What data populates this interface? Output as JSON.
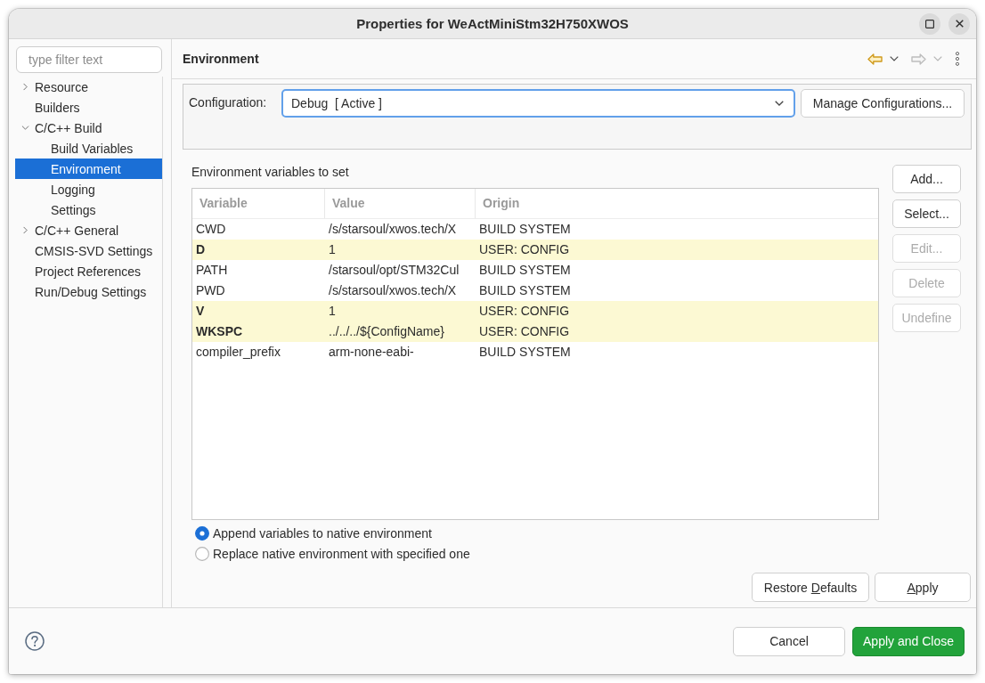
{
  "window": {
    "title": "Properties for WeActMiniStm32H750XWOS"
  },
  "sidebar": {
    "filter": {
      "placeholder": "type filter text"
    },
    "items": [
      {
        "label": "Resource",
        "kind": "group",
        "expanded": false,
        "selected": false
      },
      {
        "label": "Builders",
        "kind": "page",
        "selected": false
      },
      {
        "label": "C/C++ Build",
        "kind": "group",
        "expanded": true,
        "selected": false,
        "children": [
          {
            "label": "Build Variables",
            "kind": "page",
            "selected": false
          },
          {
            "label": "Environment",
            "kind": "page",
            "selected": true
          },
          {
            "label": "Logging",
            "kind": "page",
            "selected": false
          },
          {
            "label": "Settings",
            "kind": "page",
            "selected": false
          }
        ]
      },
      {
        "label": "C/C++ General",
        "kind": "group",
        "expanded": false,
        "selected": false
      },
      {
        "label": "CMSIS-SVD Settings",
        "kind": "page",
        "selected": false
      },
      {
        "label": "Project References",
        "kind": "page",
        "selected": false
      },
      {
        "label": "Run/Debug Settings",
        "kind": "page",
        "selected": false
      }
    ]
  },
  "page": {
    "title": "Environment",
    "history": [
      {
        "kind": "back",
        "disabled": false
      },
      {
        "kind": "forward",
        "disabled": true
      }
    ],
    "configuration": {
      "label": "Configuration:",
      "value": "Debug  [ Active ]",
      "focused": true,
      "manage_button": "Manage Configurations..."
    },
    "variables": {
      "label": "Environment variables to set",
      "columns": [
        "Variable",
        "Value",
        "Origin"
      ],
      "rows": [
        {
          "variable": "CWD",
          "value": "/s/starsoul/xwos.tech/X",
          "origin": "BUILD SYSTEM",
          "user_defined": false
        },
        {
          "variable": "D",
          "value": "1",
          "origin": "USER: CONFIG",
          "user_defined": true
        },
        {
          "variable": "PATH",
          "value": "/starsoul/opt/STM32Cul",
          "origin": "BUILD SYSTEM",
          "user_defined": false
        },
        {
          "variable": "PWD",
          "value": "/s/starsoul/xwos.tech/X",
          "origin": "BUILD SYSTEM",
          "user_defined": false
        },
        {
          "variable": "V",
          "value": "1",
          "origin": "USER: CONFIG",
          "user_defined": true
        },
        {
          "variable": "WKSPC",
          "value": "../../../${ConfigName}",
          "origin": "USER: CONFIG",
          "user_defined": true
        },
        {
          "variable": "compiler_prefix",
          "value": "arm-none-eabi-",
          "origin": "BUILD SYSTEM",
          "user_defined": false
        }
      ],
      "buttons": [
        {
          "label": "Add...",
          "disabled": false
        },
        {
          "label": "Select...",
          "disabled": false
        },
        {
          "label": "Edit...",
          "disabled": true
        },
        {
          "label": "Delete",
          "disabled": true
        },
        {
          "label": "Undefine",
          "disabled": true
        }
      ]
    },
    "mode_options": [
      {
        "label": "Append variables to native environment",
        "selected": true
      },
      {
        "label": "Replace native environment with specified one",
        "selected": false
      }
    ],
    "actions": [
      {
        "text_before": "Restore ",
        "access_key": "D",
        "text_after": "efaults"
      },
      {
        "access_key": "A",
        "text_after": "pply"
      }
    ]
  },
  "footer": {
    "buttons": [
      {
        "label": "Cancel",
        "primary": false
      },
      {
        "label": "Apply and Close",
        "primary": true
      }
    ]
  }
}
